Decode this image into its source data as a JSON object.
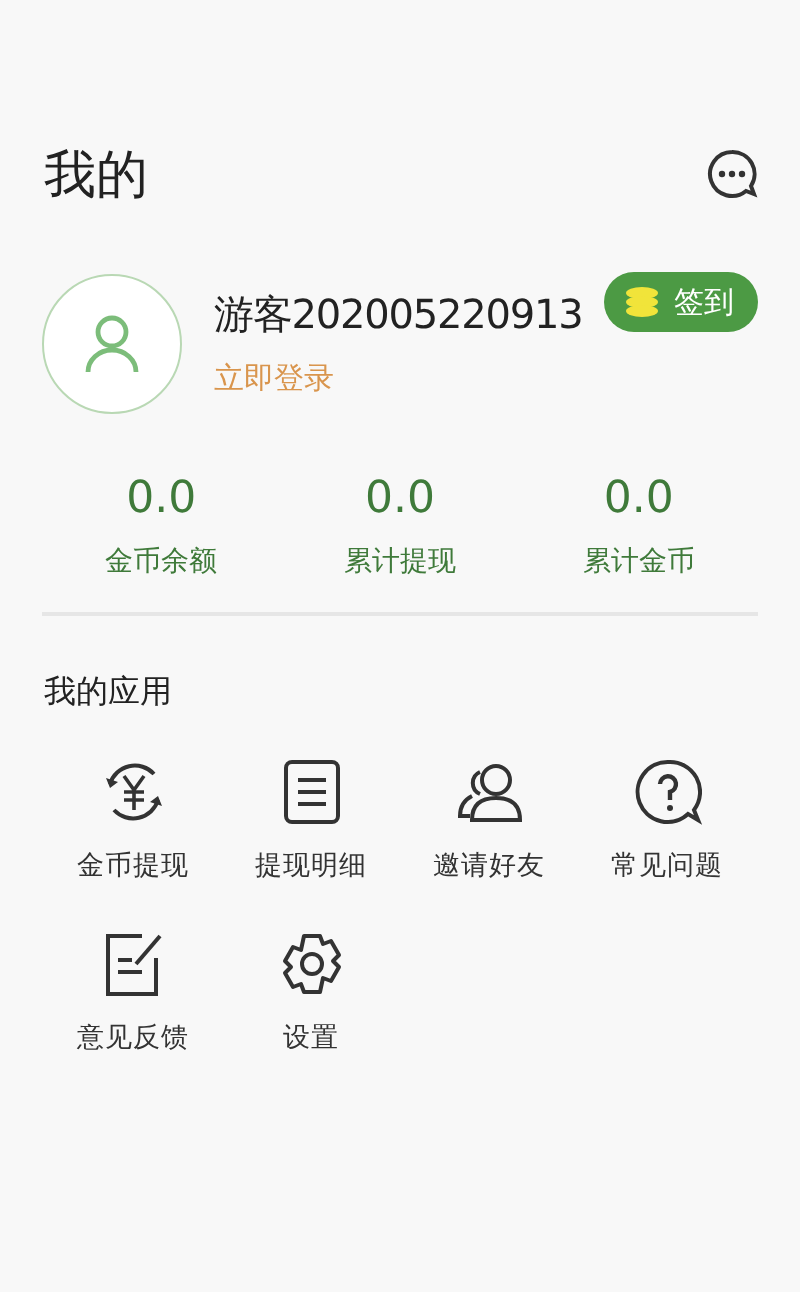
{
  "header": {
    "title": "我的"
  },
  "profile": {
    "name": "游客202005220913",
    "login_link": "立即登录",
    "checkin_button": "签到"
  },
  "stats": [
    {
      "value": "0.0",
      "label": "金币余额"
    },
    {
      "value": "0.0",
      "label": "累计提现"
    },
    {
      "value": "0.0",
      "label": "累计金币"
    }
  ],
  "apps": {
    "title": "我的应用",
    "items": [
      {
        "label": "金币提现",
        "kind": "exchange"
      },
      {
        "label": "提现明细",
        "kind": "list"
      },
      {
        "label": "邀请好友",
        "kind": "friends"
      },
      {
        "label": "常见问题",
        "kind": "question"
      },
      {
        "label": "意见反馈",
        "kind": "feedback"
      },
      {
        "label": "设置",
        "kind": "settings"
      }
    ]
  }
}
